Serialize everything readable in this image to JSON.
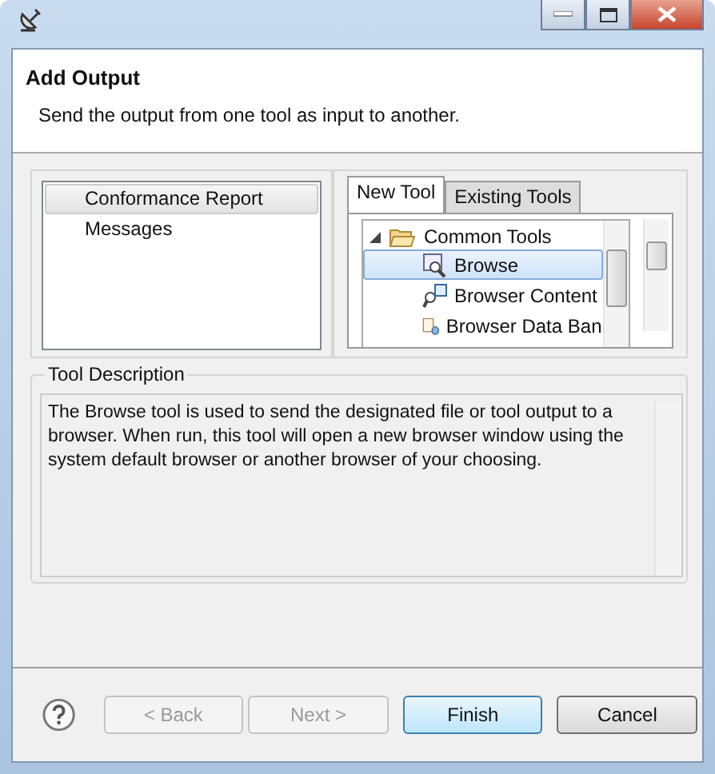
{
  "header": {
    "title": "Add Output",
    "description": "Send the output from one tool as input to another."
  },
  "outputs": [
    {
      "label": "Conformance Report",
      "selected": true
    },
    {
      "label": "Messages",
      "selected": false
    }
  ],
  "tabs": [
    {
      "label": "New Tool",
      "selected": true
    },
    {
      "label": "Existing Tools",
      "selected": false
    }
  ],
  "tree": {
    "label": "Common Tools",
    "expanded": true,
    "children": [
      {
        "label": "Browse",
        "selected": true,
        "kind": "browse"
      },
      {
        "label": "Browser Content",
        "selected": false,
        "kind": "contents"
      },
      {
        "label": "Browser Data Ban",
        "selected": false,
        "kind": "data"
      }
    ]
  },
  "tool_description": {
    "title": "Tool Description",
    "text": "The Browse tool is used to send the designated file or tool output to a browser. When run, this tool will open a new browser window using the system default browser or another browser of your choosing."
  },
  "buttons": [
    {
      "label": "< Back",
      "disabled": true,
      "default": false
    },
    {
      "label": "Next >",
      "disabled": true,
      "default": false
    },
    {
      "label": "Finish",
      "disabled": false,
      "default": true
    },
    {
      "label": "Cancel",
      "disabled": false,
      "default": false
    }
  ]
}
